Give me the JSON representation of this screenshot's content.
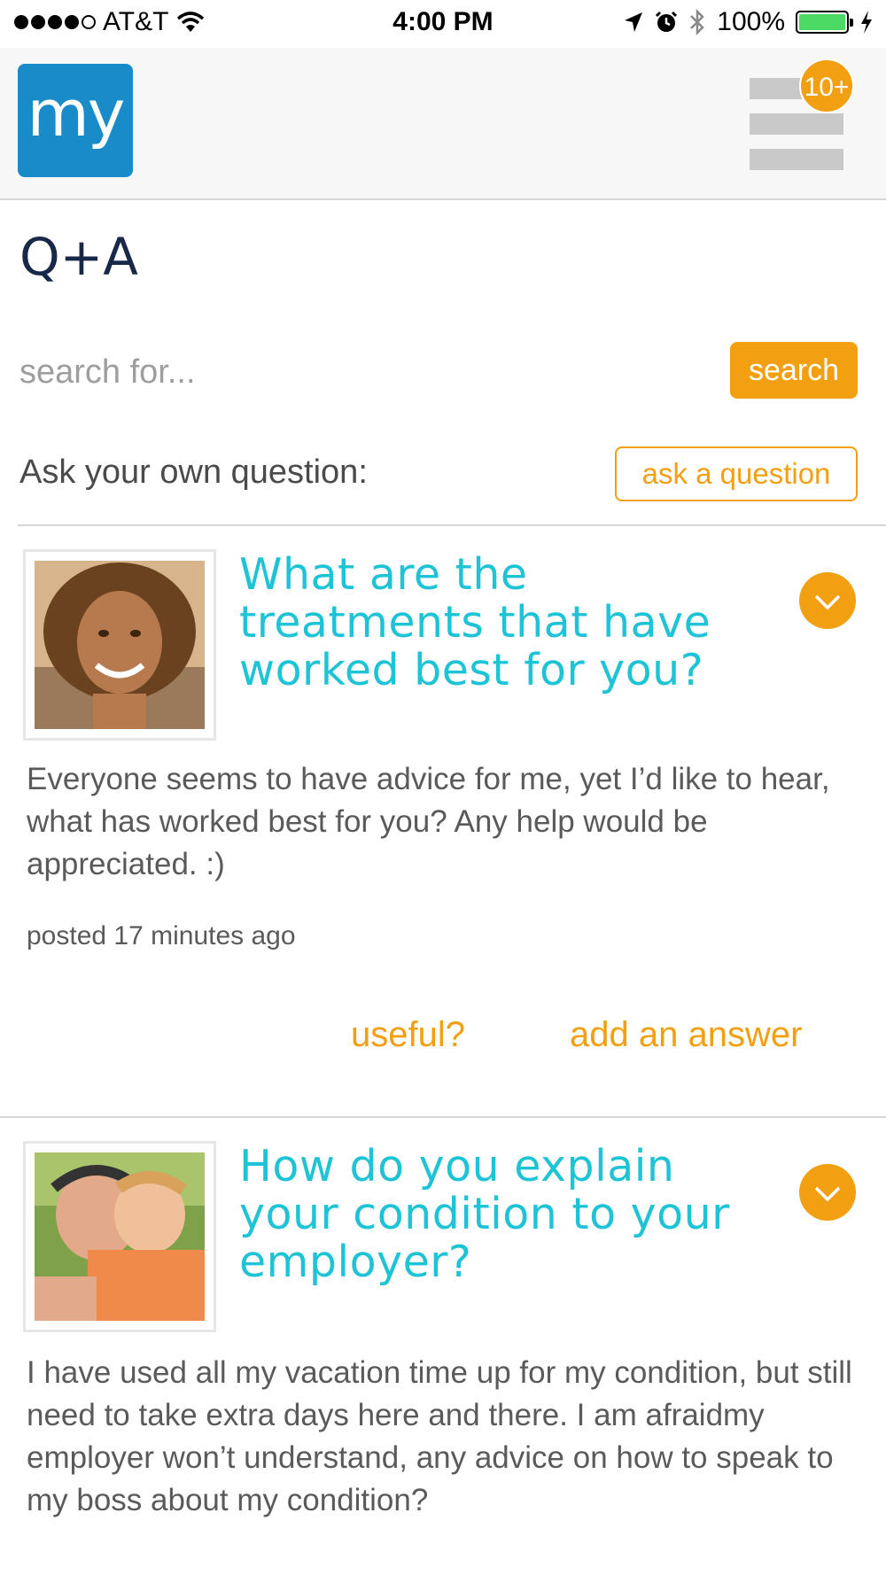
{
  "status_bar": {
    "carrier": "AT&T",
    "time": "4:00 PM",
    "battery": "100%",
    "battery_level": 1.0
  },
  "header": {
    "logo_text": "my",
    "notification_badge": "10+"
  },
  "page": {
    "title": "Q+A"
  },
  "search": {
    "placeholder": "search for...",
    "button_label": "search"
  },
  "ask": {
    "label": "Ask your own question:",
    "button_label": "ask a question"
  },
  "questions": [
    {
      "title": "What are the treatments that have worked best for you?",
      "body": "Everyone seems to have advice for me, yet I’d like to hear, what has worked best for you? Any help would be appreciated. :)",
      "posted": "posted 17 minutes ago",
      "useful_label": "useful?",
      "answer_label": "add an answer"
    },
    {
      "title": "How do you explain your condition to your employer?",
      "body": "I have used all my vacation time up for my condition, but still need to take extra days here and there.  I am afraidmy employer won’t understand, any advice on how to speak to my boss about my condition?"
    }
  ],
  "colors": {
    "accent_orange": "#f29f12",
    "title_teal": "#1ec4d6",
    "logo_blue": "#1a8bc9",
    "page_title_navy": "#172849"
  }
}
